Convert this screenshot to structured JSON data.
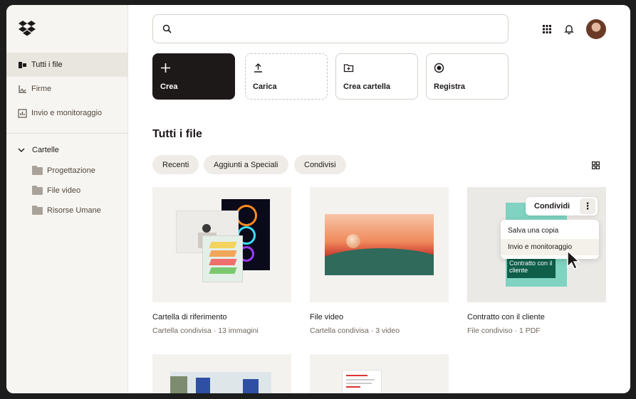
{
  "sidebar": {
    "items": [
      {
        "label": "Tutti i file",
        "icon": "files-icon"
      },
      {
        "label": "Firme",
        "icon": "signature-icon"
      },
      {
        "label": "Invio e monitoraggio",
        "icon": "chart-icon"
      }
    ],
    "folders_label": "Cartelle",
    "folders": [
      "Progettazione",
      "File video",
      "Risorse Umane"
    ]
  },
  "search": {
    "placeholder": "",
    "value": ""
  },
  "actions": [
    "Crea",
    "Carica",
    "Crea cartella",
    "Registra"
  ],
  "section_title": "Tutti i file",
  "filters": [
    "Recenti",
    "Aggiunti a Speciali",
    "Condivisi"
  ],
  "cards": [
    {
      "title": "Cartella di riferimento",
      "subtitle": "Cartella condivisa · 13 immagini"
    },
    {
      "title": "File video",
      "subtitle": "Cartella condivisa · 3 video"
    },
    {
      "title": "Contratto con il cliente",
      "subtitle": "File condiviso · 1 PDF"
    }
  ],
  "card_overlay_text": "Contratto con il cliente",
  "context_menu": {
    "share_label": "Condividi",
    "more_label": "⋮",
    "items": [
      "Salva una copia",
      "Invio e monitoraggio"
    ]
  },
  "colors": {
    "primary": "#1e1919",
    "accent_teal": "#7fd3c0",
    "sidebar_bg": "#f7f5f2"
  }
}
